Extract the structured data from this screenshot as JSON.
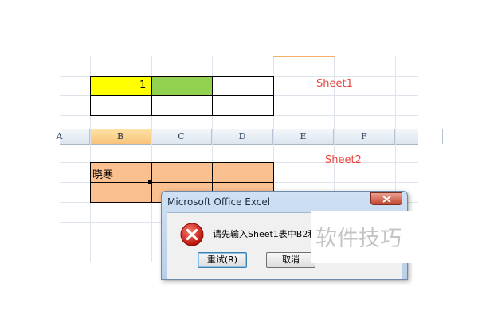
{
  "sheet1": {
    "label": "Sheet1",
    "cell_b2_value": "1",
    "colors": {
      "b2": "#ffff00",
      "c2": "#92d050"
    }
  },
  "sheet2": {
    "label": "Sheet2",
    "columns": [
      "A",
      "B",
      "C",
      "D",
      "E",
      "F"
    ],
    "selected_column": "B",
    "cell_b_value": "晓寒",
    "colors": {
      "fill": "#fac090"
    }
  },
  "dialog": {
    "title": "Microsoft Office Excel",
    "icon": "error-icon",
    "message": "请先输入Sheet1表中B2和C",
    "retry_label": "重试(R)",
    "cancel_label": "取消",
    "close_icon": "close-icon"
  },
  "watermark": "软件技巧"
}
